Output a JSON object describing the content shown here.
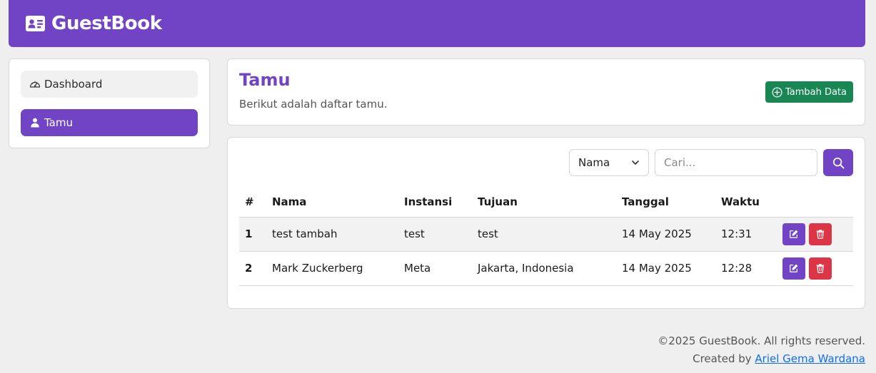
{
  "header": {
    "brand": "GuestBook"
  },
  "sidebar": {
    "items": [
      {
        "label": "Dashboard",
        "icon": "gauge-icon",
        "active": false
      },
      {
        "label": "Tamu",
        "icon": "person-icon",
        "active": true
      }
    ]
  },
  "page": {
    "title": "Tamu",
    "subtitle": "Berikut adalah daftar tamu.",
    "add_label": "Tambah Data"
  },
  "search": {
    "field_selected": "Nama",
    "placeholder": "Cari..."
  },
  "table": {
    "headers": [
      "#",
      "Nama",
      "Instansi",
      "Tujuan",
      "Tanggal",
      "Waktu"
    ],
    "rows": [
      {
        "no": "1",
        "nama": "test tambah",
        "instansi": "test",
        "tujuan": "test",
        "tanggal": "14 May 2025",
        "waktu": "12:31"
      },
      {
        "no": "2",
        "nama": "Mark Zuckerberg",
        "instansi": "Meta",
        "tujuan": "Jakarta, Indonesia",
        "tanggal": "14 May 2025",
        "waktu": "12:28"
      }
    ]
  },
  "footer": {
    "copyright": "©2025 GuestBook. All rights reserved.",
    "created_prefix": "Created by ",
    "author": "Ariel Gema Wardana"
  },
  "colors": {
    "primary": "#7044c4",
    "success": "#198754",
    "danger": "#dc3545",
    "link": "#0d6efd"
  }
}
